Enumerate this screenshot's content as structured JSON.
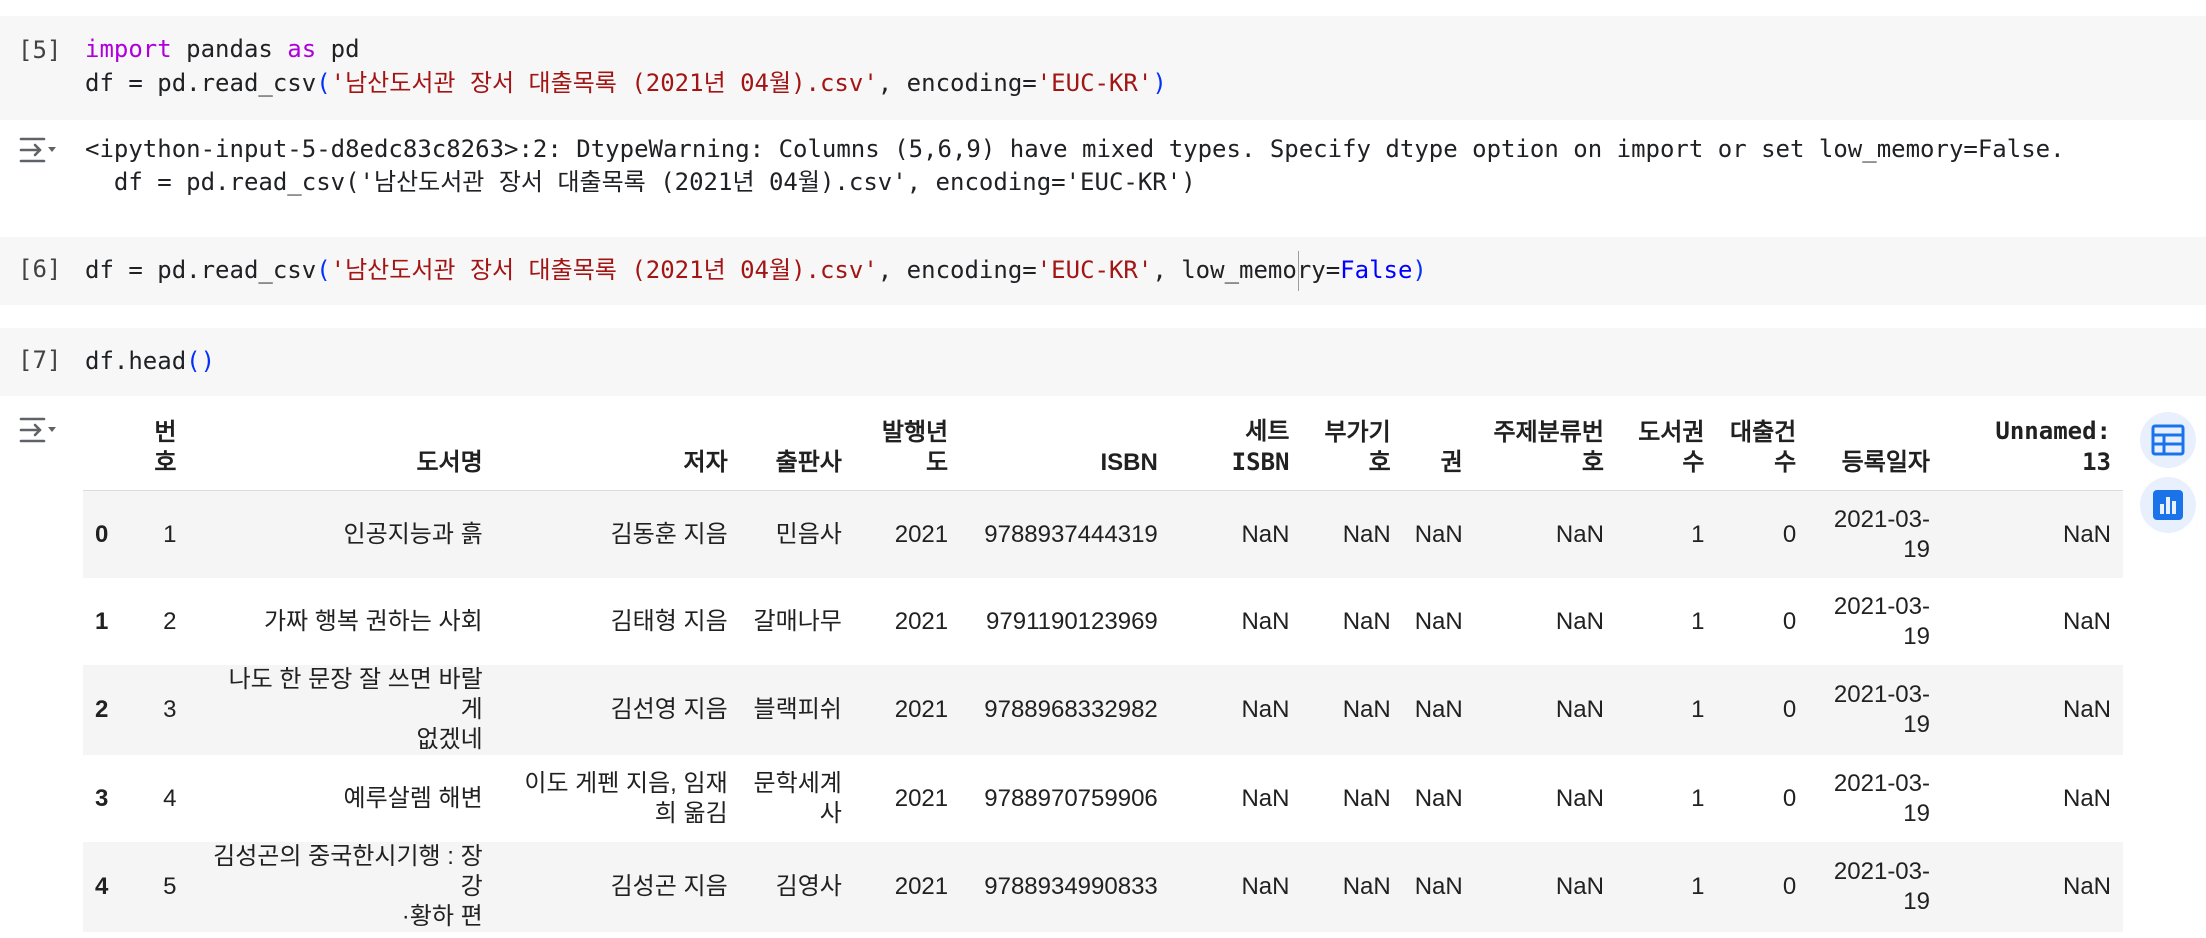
{
  "cells": [
    {
      "exec_count": "[5]",
      "line1": {
        "kw1": "import",
        "t1": " pandas ",
        "kw2": "as",
        "t2": " pd"
      },
      "line2": {
        "a": "df = pd.read_csv",
        "lp": "(",
        "s1": "'남산도서관 장서 대출목록 (2021년 04월).csv'",
        "b": ", encoding=",
        "s2": "'EUC-KR'",
        "rp": ")"
      },
      "output_icon": "collapse-output-icon",
      "warning_line1": "<ipython-input-5-d8edc83c8263>:2: DtypeWarning: Columns (5,6,9) have mixed types. Specify dtype option on import or set low_memory=False.",
      "warning_line2": "  df = pd.read_csv('남산도서관 장서 대출목록 (2021년 04월).csv', encoding='EUC-KR')"
    },
    {
      "exec_count": "[6]",
      "line1": {
        "a": "df = pd.read_csv",
        "lp": "(",
        "s1": "'남산도서관 장서 대출목록 (2021년 04월).csv'",
        "b": ", encoding=",
        "s2": "'EUC-KR'",
        "c": ", low_memory=",
        "k": "False",
        "rp": ")"
      }
    },
    {
      "exec_count": "[7]",
      "line1": {
        "a": "df.head",
        "p": "()"
      },
      "output_icon": "collapse-output-icon"
    }
  ],
  "dataframe": {
    "columns": [
      {
        "l1": "",
        "l2": ""
      },
      {
        "l1": "번",
        "l2": "호"
      },
      {
        "l1": "",
        "l2": "도서명"
      },
      {
        "l1": "",
        "l2": "저자"
      },
      {
        "l1": "",
        "l2": "출판사"
      },
      {
        "l1": "발행년",
        "l2": "도"
      },
      {
        "l1": "",
        "l2": "ISBN"
      },
      {
        "l1": "세트",
        "l2": "ISBN"
      },
      {
        "l1": "부가기",
        "l2": "호"
      },
      {
        "l1": "",
        "l2": "권"
      },
      {
        "l1": "주제분류번",
        "l2": "호"
      },
      {
        "l1": "도서권",
        "l2": "수"
      },
      {
        "l1": "대출건",
        "l2": "수"
      },
      {
        "l1": "",
        "l2": "등록일자"
      },
      {
        "l1": "Unnamed:",
        "l2": "13"
      }
    ],
    "rows": [
      {
        "idx": "0",
        "no": "1",
        "title": [
          "인공지능과 흙"
        ],
        "author": [
          "김동훈 지음"
        ],
        "publisher": [
          "민음사"
        ],
        "year": "2021",
        "isbn": "9788937444319",
        "set_isbn": "NaN",
        "addl": "NaN",
        "vol": "NaN",
        "subject": "NaN",
        "copies": "1",
        "loans": "0",
        "date": [
          "2021-03-",
          "19"
        ],
        "unnamed": "NaN"
      },
      {
        "idx": "1",
        "no": "2",
        "title": [
          "가짜 행복 권하는 사회"
        ],
        "author": [
          "김태형 지음"
        ],
        "publisher": [
          "갈매나무"
        ],
        "year": "2021",
        "isbn": "9791190123969",
        "set_isbn": "NaN",
        "addl": "NaN",
        "vol": "NaN",
        "subject": "NaN",
        "copies": "1",
        "loans": "0",
        "date": [
          "2021-03-",
          "19"
        ],
        "unnamed": "NaN"
      },
      {
        "idx": "2",
        "no": "3",
        "title": [
          "나도 한 문장 잘 쓰면 바랄 게",
          "없겠네"
        ],
        "author": [
          "김선영 지음"
        ],
        "publisher": [
          "블랙피쉬"
        ],
        "year": "2021",
        "isbn": "9788968332982",
        "set_isbn": "NaN",
        "addl": "NaN",
        "vol": "NaN",
        "subject": "NaN",
        "copies": "1",
        "loans": "0",
        "date": [
          "2021-03-",
          "19"
        ],
        "unnamed": "NaN"
      },
      {
        "idx": "3",
        "no": "4",
        "title": [
          "예루살렘 해변"
        ],
        "author": [
          "이도 게펜 지음, 임재",
          "희 옮김"
        ],
        "publisher": [
          "문학세계",
          "사"
        ],
        "year": "2021",
        "isbn": "9788970759906",
        "set_isbn": "NaN",
        "addl": "NaN",
        "vol": "NaN",
        "subject": "NaN",
        "copies": "1",
        "loans": "0",
        "date": [
          "2021-03-",
          "19"
        ],
        "unnamed": "NaN"
      },
      {
        "idx": "4",
        "no": "5",
        "title": [
          "김성곤의 중국한시기행 : 장강",
          "·황하 편"
        ],
        "author": [
          "김성곤 지음"
        ],
        "publisher": [
          "김영사"
        ],
        "year": "2021",
        "isbn": "9788934990833",
        "set_isbn": "NaN",
        "addl": "NaN",
        "vol": "NaN",
        "subject": "NaN",
        "copies": "1",
        "loans": "0",
        "date": [
          "2021-03-",
          "19"
        ],
        "unnamed": "NaN"
      }
    ]
  },
  "side_buttons": [
    {
      "icon": "table-icon",
      "color": "#1a73e8"
    },
    {
      "icon": "bar-chart-icon",
      "color": "#1a73e8"
    }
  ]
}
